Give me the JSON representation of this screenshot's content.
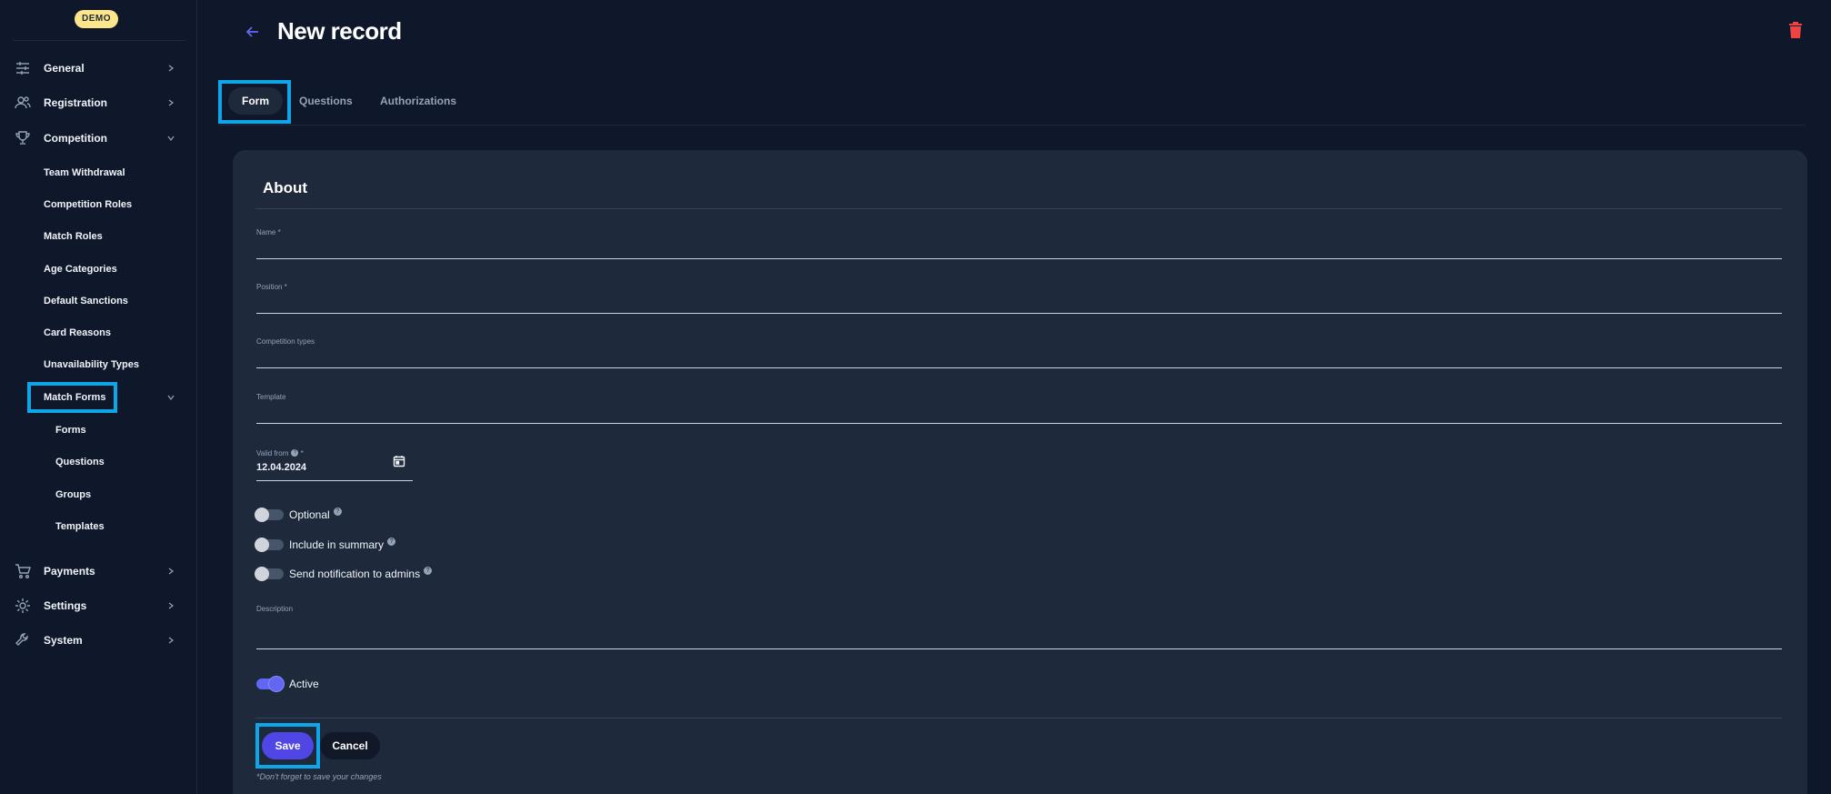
{
  "sidebar": {
    "badge": "DEMO",
    "items": [
      {
        "label": "General",
        "icon": "sliders-icon"
      },
      {
        "label": "Registration",
        "icon": "users-icon"
      },
      {
        "label": "Competition",
        "icon": "trophy-icon"
      },
      {
        "label": "Payments",
        "icon": "cart-icon"
      },
      {
        "label": "Settings",
        "icon": "gear-icon"
      },
      {
        "label": "System",
        "icon": "wrench-icon"
      }
    ],
    "competition_sub": [
      "Team Withdrawal",
      "Competition Roles",
      "Match Roles",
      "Age Categories",
      "Default Sanctions",
      "Card Reasons",
      "Unavailability Types",
      "Match Forms"
    ],
    "match_forms_sub": [
      "Forms",
      "Questions",
      "Groups",
      "Templates"
    ]
  },
  "header": {
    "title": "New record"
  },
  "tabs": [
    {
      "label": "Form",
      "active": true
    },
    {
      "label": "Questions",
      "active": false
    },
    {
      "label": "Authorizations",
      "active": false
    }
  ],
  "form": {
    "section_title": "About",
    "fields": {
      "name_label": "Name *",
      "position_label": "Position *",
      "competition_types_label": "Competition types",
      "template_label": "Template",
      "valid_from_label": "Valid from",
      "valid_from_required": "*",
      "valid_from_value": "12.04.2024",
      "description_label": "Description"
    },
    "toggles": [
      {
        "label": "Optional",
        "on": false,
        "help": true
      },
      {
        "label": "Include in summary",
        "on": false,
        "help": true
      },
      {
        "label": "Send notification to admins",
        "on": false,
        "help": true
      }
    ],
    "active_toggle": {
      "label": "Active",
      "on": true
    },
    "save_label": "Save",
    "cancel_label": "Cancel",
    "save_note": "*Don't forget to save your changes"
  },
  "colors": {
    "background": "#0f172a",
    "card": "#1e293b",
    "accent": "#4f46e5",
    "highlight": "#0ea5e9",
    "danger": "#ef4444",
    "badge": "#fde68a"
  }
}
